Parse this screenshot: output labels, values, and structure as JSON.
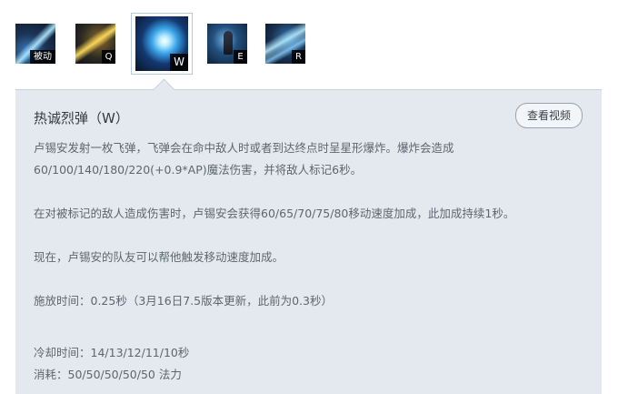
{
  "tabs": [
    {
      "key_label": "被动",
      "icon": "passive-skill-icon"
    },
    {
      "key_label": "Q",
      "icon": "q-skill-icon"
    },
    {
      "key_label": "W",
      "icon": "w-skill-icon",
      "selected": true
    },
    {
      "key_label": "E",
      "icon": "e-skill-icon"
    },
    {
      "key_label": "R",
      "icon": "r-skill-icon"
    }
  ],
  "skill": {
    "title": "热诚烈弹（W）",
    "video_button": "查看视频",
    "desc_line1": "卢锡安发射一枚飞弹，飞弹会在命中敌人时或者到达终点时呈星形爆炸。爆炸会造成",
    "desc_line2": "60/100/140/180/220(+0.9*AP)魔法伤害，并将敌人标记6秒。",
    "desc_line3": "在对被标记的敌人造成伤害时，卢锡安会获得60/65/70/75/80移动速度加成，此加成持续1秒。",
    "desc_line4": "现在，卢锡安的队友可以帮他触发移动速度加成。",
    "cast_time": "施放时间：0.25秒（3月16日7.5版本更新，此前为0.3秒）",
    "cooldown": "冷却时间：14/13/12/11/10秒",
    "cost": "消耗：50/50/50/50/50 法力"
  },
  "colors": {
    "panel_bg": "#e4e9ef",
    "title_text": "#333a44",
    "body_text": "#5d6670",
    "active_border": "#b7c9dc"
  }
}
